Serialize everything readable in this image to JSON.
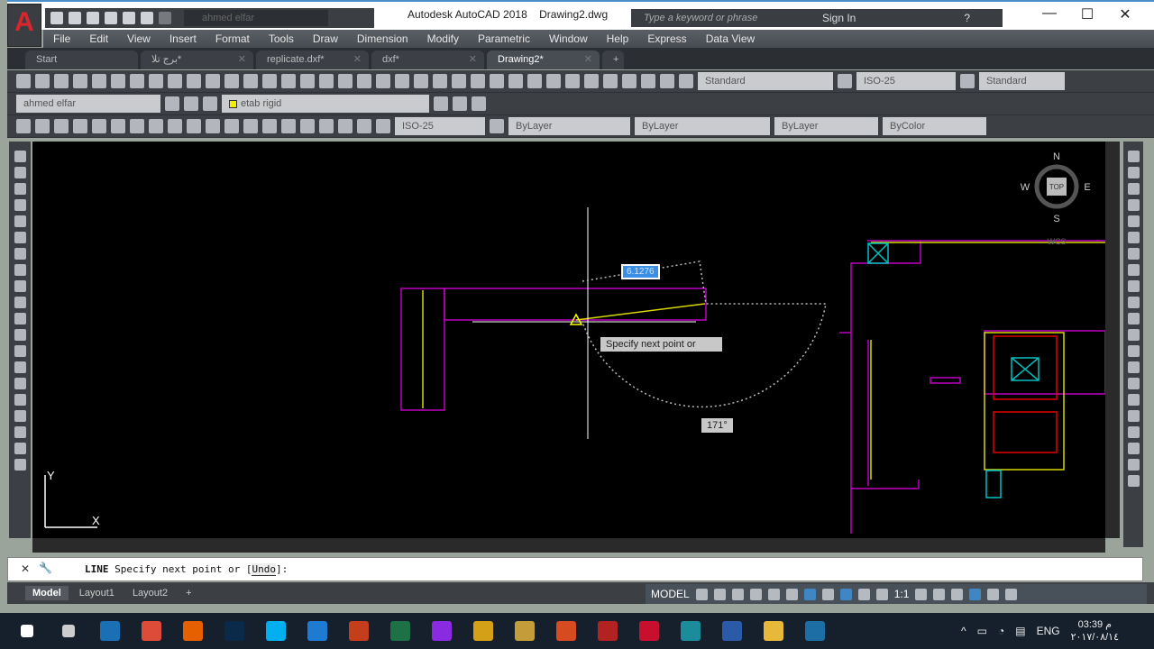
{
  "app": {
    "title": "Autodesk AutoCAD 2018",
    "document": "Drawing2.dwg",
    "logo": "A",
    "workspace": "ahmed elfar"
  },
  "search": {
    "placeholder": "Type a keyword or phrase"
  },
  "account": {
    "sign_in": "Sign In"
  },
  "window_controls": {
    "minimize": "—",
    "maximize": "☐",
    "close": "✕"
  },
  "menu": [
    "File",
    "Edit",
    "View",
    "Insert",
    "Format",
    "Tools",
    "Draw",
    "Dimension",
    "Modify",
    "Parametric",
    "Window",
    "Help",
    "Express",
    "Data View"
  ],
  "file_tabs": [
    {
      "label": "Start",
      "active": false
    },
    {
      "label": "برج تلا*",
      "active": false
    },
    {
      "label": "replicate.dxf*",
      "active": false
    },
    {
      "label": "dxf*",
      "active": false
    },
    {
      "label": "Drawing2*",
      "active": true
    }
  ],
  "toolbar": {
    "text_style": "Standard",
    "dim_style": "ISO-25",
    "table_style": "Standard",
    "workspace_combo": "ahmed elfar",
    "layer": "etab rigid",
    "layer_color": "#f0f000",
    "dim_style2": "ISO-25",
    "color": "ByLayer",
    "linetype": "ByLayer",
    "lineweight": "ByLayer",
    "plot_style": "ByColor"
  },
  "viewcube": {
    "n": "N",
    "s": "S",
    "e": "E",
    "w": "W",
    "face": "TOP",
    "ucs": "WCS"
  },
  "drawing": {
    "dynamic_length": "6.1276",
    "angle": "171°",
    "tooltip": "Specify next point or",
    "ucs_x": "X",
    "ucs_y": "Y",
    "colors": {
      "walls": "#c000c0",
      "lines": "#d8d800",
      "stairs": "#e00000",
      "hatch": "#00c0c0"
    }
  },
  "command_line": {
    "prefix": "LINE",
    "text": "Specify next point or [",
    "option": "Undo",
    "suffix": "]:"
  },
  "layout_tabs": [
    {
      "label": "Model",
      "active": true
    },
    {
      "label": "Layout1",
      "active": false
    },
    {
      "label": "Layout2",
      "active": false
    }
  ],
  "status": {
    "model": "MODEL",
    "scale": "1:1"
  },
  "taskbar": {
    "apps": [
      "start",
      "search",
      "autocad-tray",
      "chrome",
      "firefox",
      "photoshop",
      "skype",
      "edge",
      "powerpoint",
      "excel",
      "winrar",
      "app-x",
      "app-grid",
      "app-star",
      "gdp",
      "autocad",
      "app-clock",
      "app-photo",
      "file-explorer",
      "app-s"
    ],
    "lang": "ENG",
    "time": "03:39 م",
    "date": "٢٠١٧/٠٨/١٤"
  }
}
